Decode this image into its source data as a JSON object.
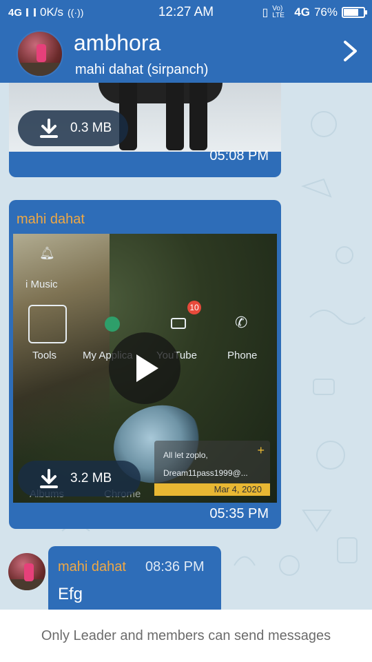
{
  "status_bar": {
    "network": "4G",
    "speed": "0K/s",
    "time": "12:27 AM",
    "volte": "Vo) LTE",
    "network_right": "4G",
    "battery": "76%",
    "battery_level": 0.76
  },
  "header": {
    "title": "ambhora",
    "subtitle": "mahi dahat (sirpanch)"
  },
  "messages": [
    {
      "type": "media",
      "download_size": "0.3 MB",
      "time": "05:08 PM"
    },
    {
      "type": "video",
      "sender": "mahi dahat",
      "download_size": "3.2 MB",
      "time": "05:35 PM",
      "thumbnail_text": {
        "music": "i Music",
        "tools": "Tools",
        "apps": "My Applica",
        "youtube": "YouTube",
        "phone": "Phone",
        "albums": "Albums",
        "chrome": "Chrome",
        "badge": "10",
        "notif_line1": "All let zoplo,",
        "notif_line2": "Dream11pass1999@...",
        "notif_date": "Mar 4, 2020",
        "notif_plus": "+"
      }
    },
    {
      "type": "text",
      "sender": "mahi dahat",
      "time": "08:36 PM",
      "text": "Efg"
    }
  ],
  "footer": {
    "note": "Only Leader and members can send messages"
  },
  "colors": {
    "primary": "#2e6db8",
    "sender_name": "#f0a844",
    "chat_background": "#d4e3ec"
  }
}
